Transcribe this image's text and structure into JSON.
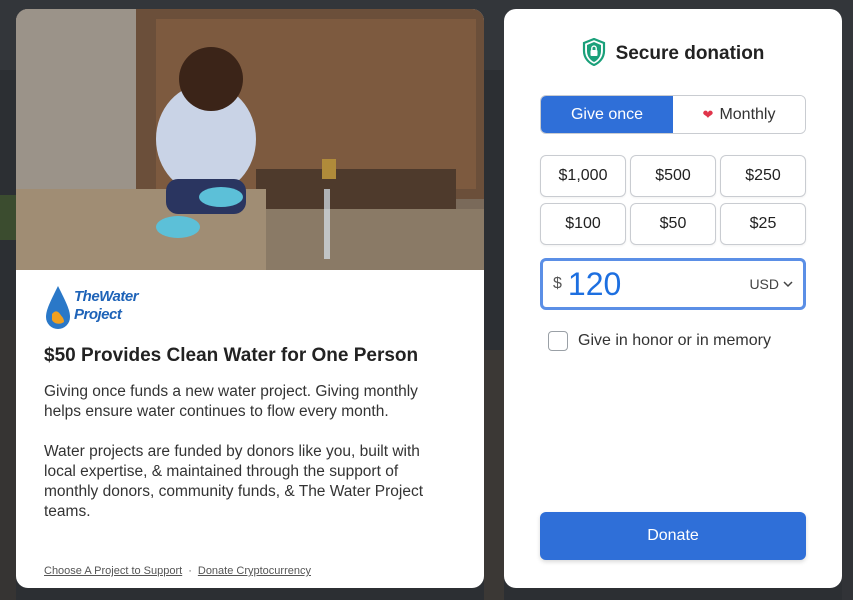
{
  "info_card": {
    "logo_line1": "TheWater",
    "logo_line2": "Project",
    "title": "$50 Provides Clean Water for One Person",
    "paragraph1": "Giving once funds a new water project. Giving monthly helps ensure water continues to flow every month.",
    "paragraph2": "Water projects are funded by donors like you, built with local expertise, & maintained through the support of monthly donors, community funds, & The Water Project teams.",
    "link1": "Choose A Project to Support",
    "separator": "·",
    "link2": "Donate Cryptocurrency"
  },
  "donation": {
    "header_icon": "shield-lock-icon",
    "title": "Secure donation",
    "frequency": {
      "once_label": "Give once",
      "monthly_label": "Monthly",
      "monthly_icon": "heart-icon",
      "selected": "once"
    },
    "amounts": [
      "$1,000",
      "$500",
      "$250",
      "$100",
      "$50",
      "$25"
    ],
    "currency_symbol": "$",
    "amount_value": "120",
    "currency_code": "USD",
    "honor_label": "Give in honor or in memory",
    "donate_label": "Donate"
  },
  "colors": {
    "accent": "#2f6fd8",
    "shield": "#1aa07a",
    "heart": "#e0344a"
  }
}
